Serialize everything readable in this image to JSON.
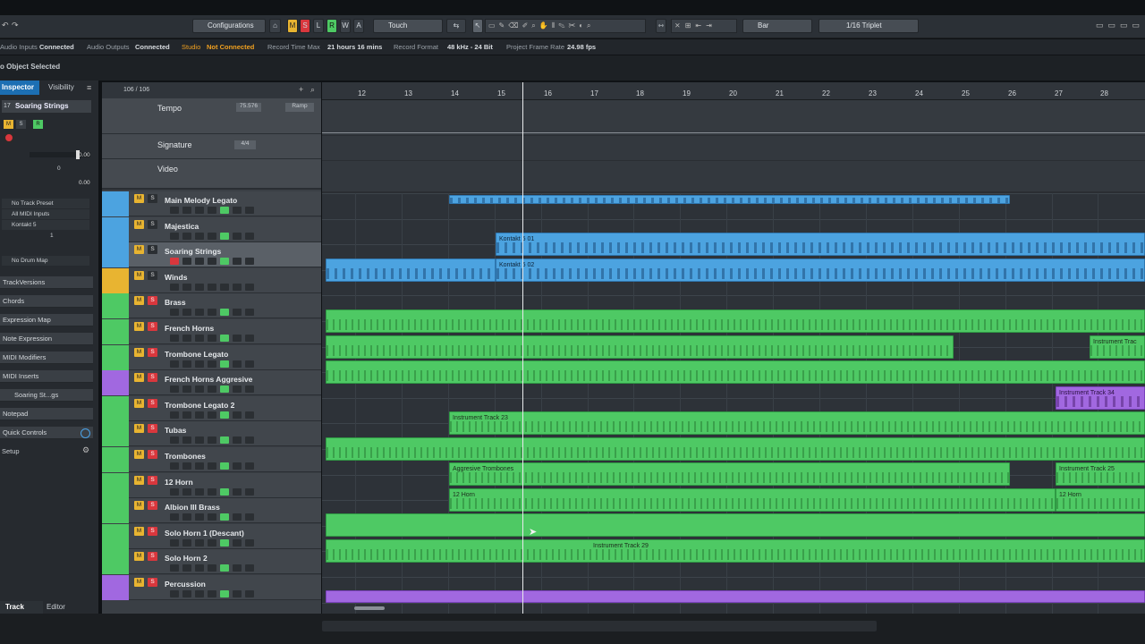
{
  "toolbar": {
    "configurations": "Configurations",
    "m_btn": "M",
    "s_btn": "S",
    "l_btn": "L",
    "r_btn": "R",
    "w_btn": "W",
    "a_btn": "A",
    "automation_mode": "Touch",
    "grid_type": "Bar",
    "quantize": "1/16 Triplet"
  },
  "status": {
    "audio_inputs_label": "Audio Inputs",
    "audio_inputs_value": "Connected",
    "audio_outputs_label": "Audio Outputs",
    "audio_outputs_value": "Connected",
    "studio_label": "Studio",
    "studio_value": "Not Connected",
    "record_time_label": "Record Time Max",
    "record_time_value": "21 hours 16 mins",
    "record_format_label": "Record Format",
    "record_format_value": "48 kHz - 24 Bit",
    "frame_rate_label": "Project Frame Rate",
    "frame_rate_value": "24.98 fps"
  },
  "info_line": "o Object Selected",
  "left": {
    "tab_inspector": "Inspector",
    "tab_visibility": "Visibility",
    "track_number": "17",
    "track_name": "Soaring Strings",
    "volume_value": "0.00",
    "pan_value": "0",
    "delay_value": "0.00",
    "preset": "No Track Preset",
    "input": "All MIDI Inputs",
    "output": "Kontakt 5",
    "channel": "1",
    "drum_map": "No Drum Map",
    "sections": [
      "TrackVersions",
      "Chords",
      "Expression Map",
      "Note Expression",
      "MIDI Modifiers",
      "MIDI Inserts",
      "Soaring St...gs",
      "Notepad",
      "Quick Controls",
      "Setup"
    ],
    "bottom_tab_track": "Track",
    "bottom_tab_editor": "Editor"
  },
  "tracklist": {
    "count": "106 / 106",
    "tempo_name": "Tempo",
    "tempo_value": "75.576",
    "tempo_mode": "Ramp",
    "signature_name": "Signature",
    "signature_value": "4/4",
    "video_name": "Video",
    "tracks": [
      {
        "name": "Main Melody Legato",
        "color": "#4ca3e0",
        "mute": "M",
        "solo": "S"
      },
      {
        "name": "Majestica",
        "color": "#4ca3e0",
        "mute": "M",
        "solo": "S"
      },
      {
        "name": "Soaring Strings",
        "color": "#4ca3e0",
        "mute": "M",
        "solo": "S"
      },
      {
        "name": "Winds",
        "color": "#e8b431",
        "mute": "M",
        "solo": "S"
      },
      {
        "name": "Brass",
        "color": "#4ec964",
        "mute": "M",
        "solo": "S"
      },
      {
        "name": "French Horns",
        "color": "#4ec964",
        "mute": "M",
        "solo": "S"
      },
      {
        "name": "Trombone Legato",
        "color": "#4ec964",
        "mute": "M",
        "solo": "S"
      },
      {
        "name": "French Horns Aggresive",
        "color": "#a168e0",
        "mute": "M",
        "solo": "S"
      },
      {
        "name": "Trombone Legato 2",
        "color": "#4ec964",
        "mute": "M",
        "solo": "S"
      },
      {
        "name": "Tubas",
        "color": "#4ec964",
        "mute": "M",
        "solo": "S"
      },
      {
        "name": "Trombones",
        "color": "#4ec964",
        "mute": "M",
        "solo": "S"
      },
      {
        "name": "12 Horn",
        "color": "#4ec964",
        "mute": "M",
        "solo": "S"
      },
      {
        "name": "Albion III Brass",
        "color": "#4ec964",
        "mute": "M",
        "solo": "S"
      },
      {
        "name": "Solo Horn 1 (Descant)",
        "color": "#4ec964",
        "mute": "M",
        "solo": "S"
      },
      {
        "name": "Solo Horn 2",
        "color": "#4ec964",
        "mute": "M",
        "solo": "S"
      },
      {
        "name": "Percussion",
        "color": "#a168e0",
        "mute": "M",
        "solo": "S"
      }
    ]
  },
  "ruler": [
    "12",
    "13",
    "14",
    "15",
    "16",
    "17",
    "18",
    "19",
    "20",
    "21",
    "22",
    "23",
    "24",
    "25",
    "26",
    "27",
    "28"
  ],
  "parts": {
    "kontakt_01": "Kontakt 5 01",
    "kontakt_02": "Kontakt 5 02",
    "instrument_track": "Instrument Trac",
    "instrument_track_34": "Instrument Track 34",
    "instrument_track_23": "Instrument Track 23",
    "aggresive_trombones": "Aggresive Trombones",
    "instrument_track_25": "Instrument Track 25",
    "horn_12_a": "12 Horn",
    "horn_12_b": "12 Horn",
    "instrument_track_29": "Instrument Track 29"
  }
}
